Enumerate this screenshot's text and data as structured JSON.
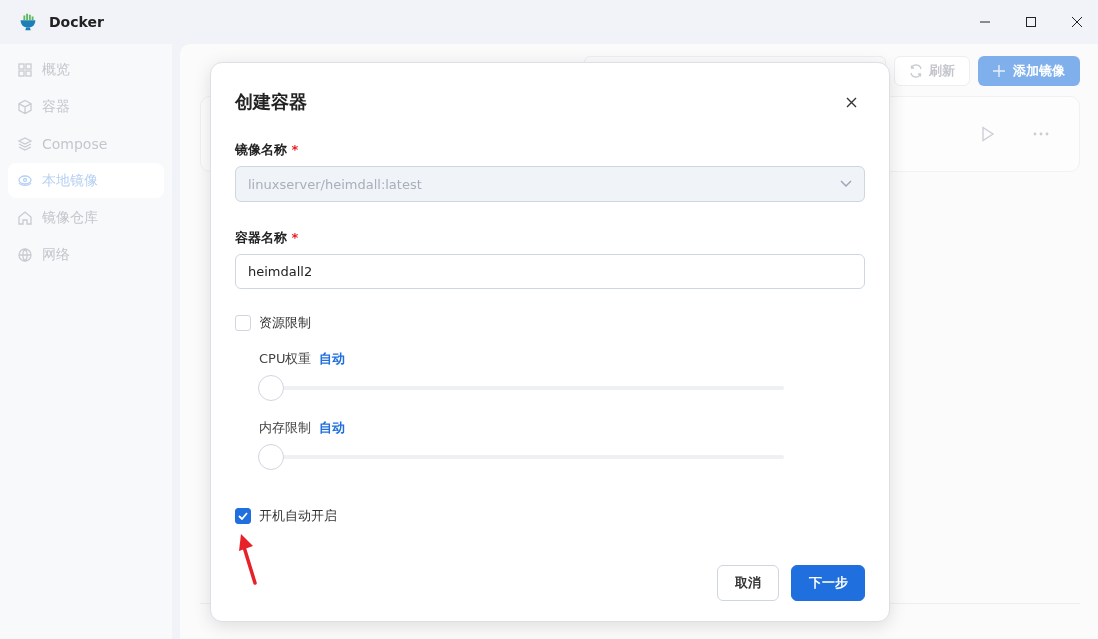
{
  "window": {
    "title": "Docker"
  },
  "sidebar": {
    "items": [
      {
        "label": "概览",
        "selected": false
      },
      {
        "label": "容器",
        "selected": false
      },
      {
        "label": "Compose",
        "selected": false
      },
      {
        "label": "本地镜像",
        "selected": true
      },
      {
        "label": "镜像仓库",
        "selected": false
      },
      {
        "label": "网络",
        "selected": false
      }
    ]
  },
  "page": {
    "refresh_button": "刷新",
    "add_button": "添加镜像"
  },
  "dialog": {
    "title": "创建容器",
    "image_field": {
      "label": "镜像名称",
      "required_mark": "*",
      "value": "linuxserver/heimdall:latest",
      "disabled": true
    },
    "name_field": {
      "label": "容器名称",
      "required_mark": "*",
      "value": "heimdall2"
    },
    "resource_limit": {
      "label": "资源限制",
      "checked": false
    },
    "sliders": [
      {
        "label": "CPU权重",
        "reading": "自动",
        "level": 0
      },
      {
        "label": "内存限制",
        "reading": "自动",
        "level": 0
      }
    ],
    "autostart": {
      "label": "开机自动开启",
      "checked": true
    },
    "buttons": [
      {
        "label": "取消",
        "kind": "secondary"
      },
      {
        "label": "下一步",
        "kind": "primary"
      }
    ]
  }
}
